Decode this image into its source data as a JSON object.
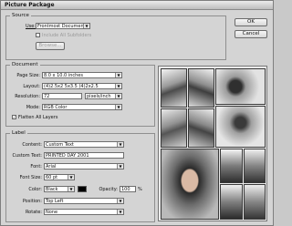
{
  "window": {
    "title": "Picture Package"
  },
  "buttons": {
    "ok": "OK",
    "cancel": "Cancel",
    "browse": "Browse..."
  },
  "source": {
    "legend": "Source",
    "use_label": "Use:",
    "use_value": "Frontmost Document",
    "include_all_label": "Include All Subfolders"
  },
  "document": {
    "legend": "Document",
    "page_size_label": "Page Size:",
    "page_size_value": "8.0 x 10.0 inches",
    "layout_label": "Layout:",
    "layout_value": "(4)2.5x2 5x3.5 (4)2x2.5",
    "resolution_label": "Resolution:",
    "resolution_value": "72",
    "resolution_unit": "pixels/inch",
    "mode_label": "Mode:",
    "mode_value": "RGB Color",
    "flatten_label": "Flatten All Layers"
  },
  "label": {
    "legend": "Label",
    "content_label": "Content:",
    "content_value": "Custom Text",
    "custom_text_label": "Custom Text:",
    "custom_text_value": "PRINTED DAY 2001",
    "font_label": "Font:",
    "font_value": "Arial",
    "font_size_label": "Font Size:",
    "font_size_value": "60 pt",
    "color_label": "Color:",
    "color_value": "Black",
    "opacity_label": "Opacity:",
    "opacity_value": "100",
    "opacity_unit": "%",
    "position_label": "Position:",
    "position_value": "Top Left",
    "rotate_label": "Rotate:",
    "rotate_value": "None"
  },
  "colors": {
    "swatch": "#000000"
  }
}
